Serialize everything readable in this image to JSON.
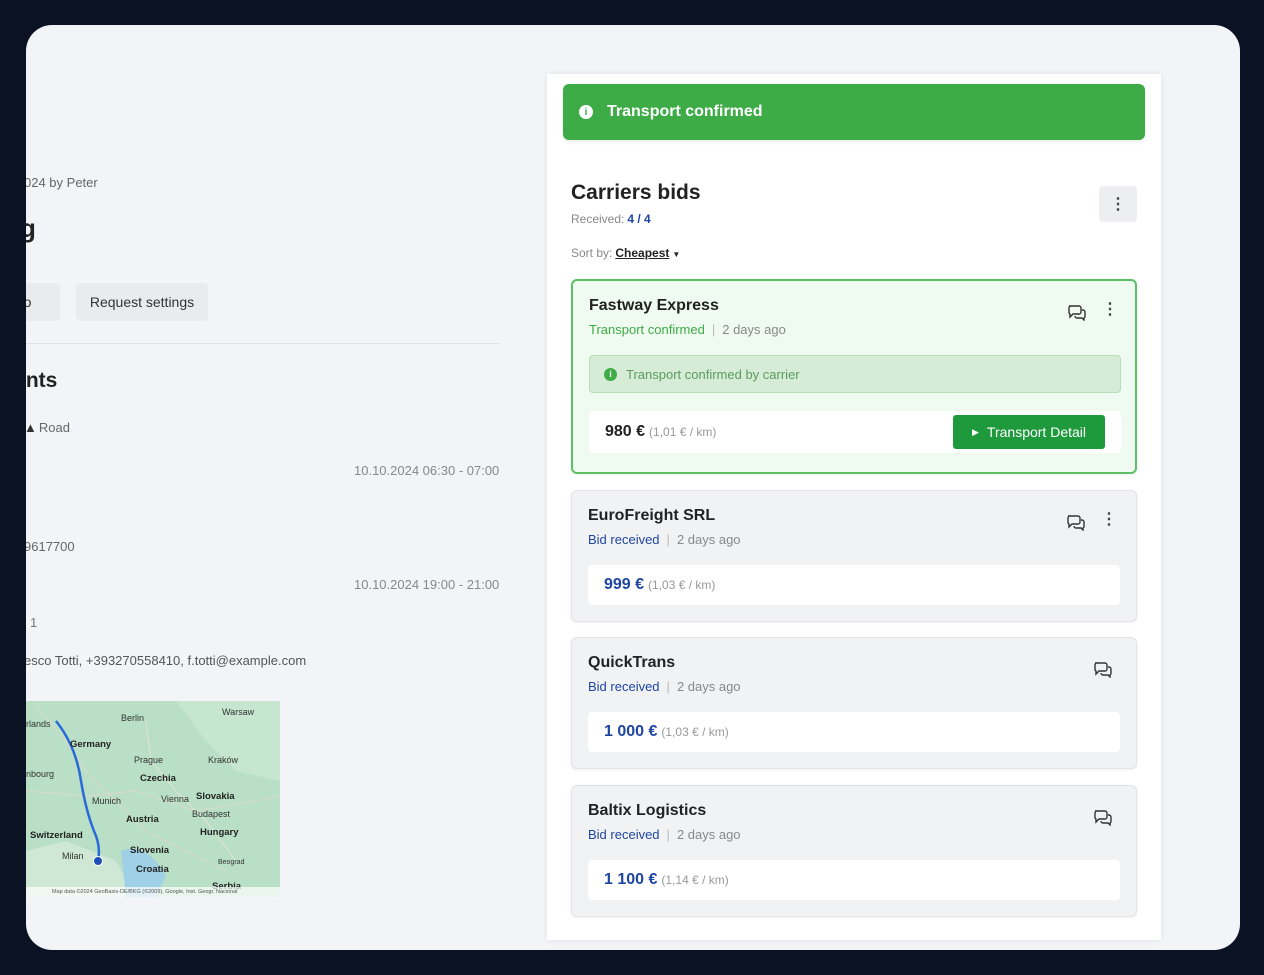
{
  "left": {
    "created_text": "024 by Peter",
    "title_fragment": "g",
    "tabs": [
      "nfo",
      "Request settings"
    ],
    "section_title": "ints",
    "transport_mode": "Road",
    "pickup_time": "10.10.2024 06:30 - 07:00",
    "phone_fragment": "9617700",
    "delivery_time": "10.10.2024 19:00 - 21:00",
    "count_fragment": "1",
    "contact": "esco Totti, +393270558410, f.totti@example.com",
    "map": {
      "labels": [
        "Berlin",
        "Warsaw",
        "rlands",
        "Germany",
        "Prague",
        "Kraków",
        "nbourg",
        "Czechia",
        "Munich",
        "Vienna",
        "Slovakia",
        "Austria",
        "Budapest",
        "Hungary",
        "Switzerland",
        "Slovenia",
        "Milan",
        "Croatia",
        "Beograd",
        "Serbia"
      ],
      "footer": "Map data ©2024 GeoBasis-DE/BKG (©2009), Google, Inst. Geogr. Nacional"
    }
  },
  "banner": {
    "text": "Transport confirmed",
    "icon": "info-icon"
  },
  "panel": {
    "title": "Carriers bids",
    "received_label": "Received:",
    "received_count": "4 / 4",
    "sort_label": "Sort by:",
    "sort_value": "Cheapest"
  },
  "bids": [
    {
      "carrier": "Fastway Express",
      "status": "Transport confirmed",
      "ago": "2 days ago",
      "notice": "Transport confirmed by carrier",
      "price": "980 €",
      "per_km": "(1,01 € / km)",
      "button": "Transport Detail"
    },
    {
      "carrier": "EuroFreight SRL",
      "status": "Bid received",
      "ago": "2 days ago",
      "price": "999 €",
      "per_km": "(1,03 € / km)"
    },
    {
      "carrier": "QuickTrans",
      "status": "Bid received",
      "ago": "2 days ago",
      "price": "1 000 €",
      "per_km": "(1,03 € / km)"
    },
    {
      "carrier": "Baltix Logistics",
      "status": "Bid received",
      "ago": "2 days ago",
      "price": "1 100 €",
      "per_km": "(1,14 € / km)"
    }
  ],
  "colors": {
    "success": "#3dac47",
    "success_dark": "#1e9a3c",
    "link_blue": "#1f45a3",
    "frame": "#0b1223"
  }
}
